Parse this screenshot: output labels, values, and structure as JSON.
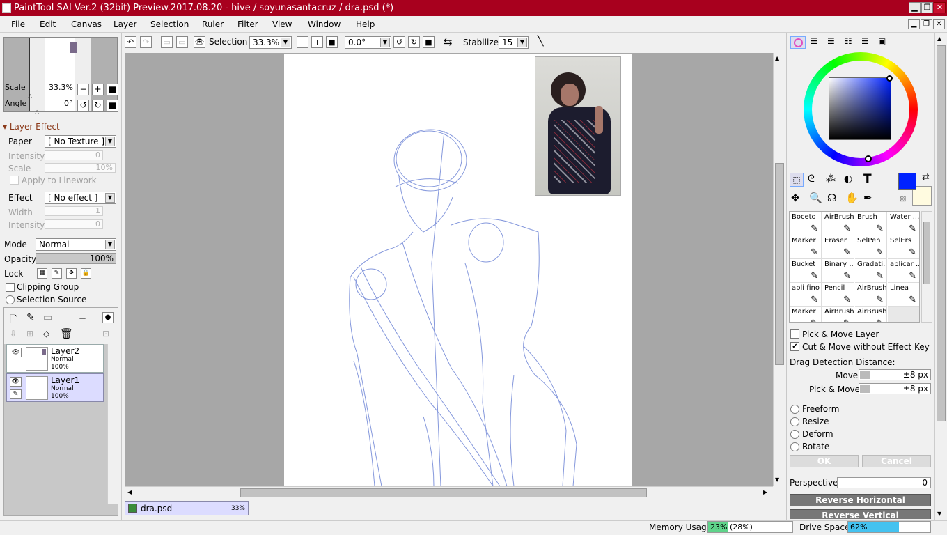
{
  "window": {
    "title": "PaintTool SAI Ver.2 (32bit) Preview.2017.08.20 - hive / soyunasantacruz / dra.psd (*)",
    "minimize": "▁",
    "restore": "❐",
    "close": "✕"
  },
  "menu": [
    "File",
    "Edit",
    "Canvas",
    "Layer",
    "Selection",
    "Ruler",
    "Filter",
    "View",
    "Window",
    "Help"
  ],
  "navigator": {
    "scale_label": "Scale",
    "scale_value": "33.3%",
    "angle_label": "Angle",
    "angle_value": "0°"
  },
  "layer_effect": {
    "header": "Layer Effect",
    "paper_label": "Paper",
    "paper_value": "[ No Texture ]",
    "intensity_label": "Intensity",
    "intensity_value": "0",
    "scale_label": "Scale",
    "scale_value": "10%",
    "apply_label": "Apply to Linework",
    "effect_label": "Effect",
    "effect_value": "[ No effect ]",
    "width_label": "Width",
    "width_value": "1",
    "intensity2_label": "Intensity",
    "intensity2_value": "0"
  },
  "layer_props": {
    "mode_label": "Mode",
    "mode_value": "Normal",
    "opacity_label": "Opacity",
    "opacity_value": "100%",
    "opacity_fraction": 1.0,
    "lock_label": "Lock",
    "clipping_label": "Clipping Group",
    "selection_source_label": "Selection Source"
  },
  "layers": [
    {
      "name": "Layer2",
      "mode": "Normal",
      "opacity": "100%",
      "selected": false
    },
    {
      "name": "Layer1",
      "mode": "Normal",
      "opacity": "100%",
      "selected": true
    }
  ],
  "toolbar": {
    "selection_label": "Selection",
    "zoom_value": "33.3%",
    "angle_value": "0.0°",
    "stabilizer_label": "Stabilizer",
    "stabilizer_value": "15"
  },
  "document_tab": {
    "name": "dra.psd",
    "zoom": "33%"
  },
  "color": {
    "primary": "#0022ff",
    "secondary": "#fffbe0"
  },
  "brushes": [
    [
      "Boceto",
      "AirBrush",
      "Brush",
      "Water ..."
    ],
    [
      "Marker",
      "Eraser",
      "SelPen",
      "SelErs"
    ],
    [
      "Bucket",
      "Binary ...",
      "Gradati...",
      "aplicar ..."
    ],
    [
      "apli fino",
      "Pencil",
      "AirBrush",
      "Linea"
    ],
    [
      "Marker",
      "AirBrush",
      "AirBrush",
      ""
    ]
  ],
  "move_options": {
    "pick_move_layer": "Pick & Move Layer",
    "cut_move": "Cut & Move without Effect Key",
    "drag_detect_label": "Drag Detection Distance:",
    "move_label": "Move",
    "move_value": "±8 px",
    "pick_move_label": "Pick & Move",
    "pick_move_value": "±8 px"
  },
  "transform": {
    "freeform": "Freeform",
    "resize": "Resize",
    "deform": "Deform",
    "rotate": "Rotate",
    "ok": "OK",
    "cancel": "Cancel",
    "perspective_label": "Perspective",
    "perspective_value": "0",
    "reverse_horizontal": "Reverse Horizontal",
    "reverse_vertical": "Reverse Vertical"
  },
  "status": {
    "memory_label": "Memory Usage",
    "memory_value": "23% (28%)",
    "memory_fraction": 0.23,
    "drive_label": "Drive Space",
    "drive_value": "62%",
    "drive_fraction": 0.62
  }
}
